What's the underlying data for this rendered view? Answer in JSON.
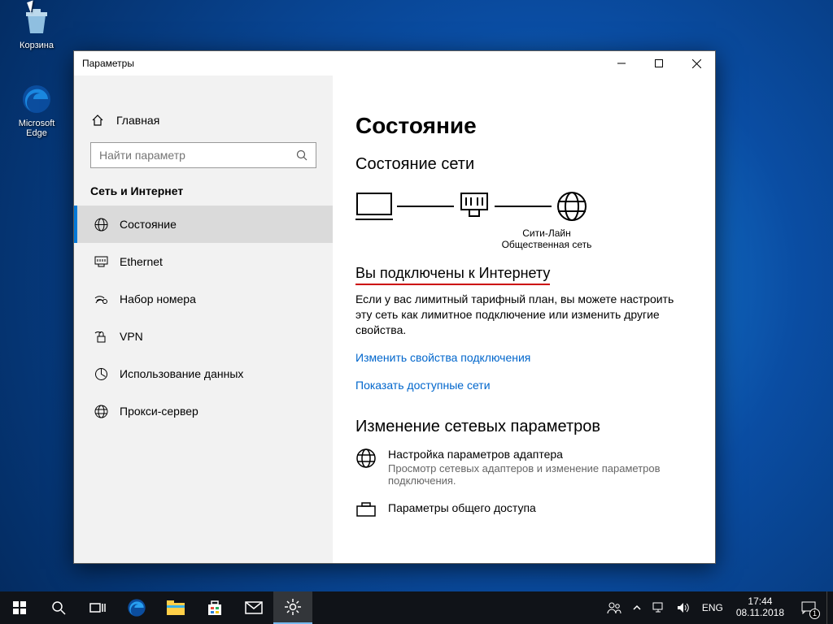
{
  "desktop": {
    "icons": [
      {
        "name": "recycle-bin",
        "label": "Корзина"
      },
      {
        "name": "edge",
        "label": "Microsoft Edge"
      }
    ]
  },
  "window": {
    "title": "Параметры",
    "sidebar": {
      "home": "Главная",
      "search_placeholder": "Найти параметр",
      "section": "Сеть и Интернет",
      "items": [
        {
          "label": "Состояние",
          "active": true
        },
        {
          "label": "Ethernet",
          "active": false
        },
        {
          "label": "Набор номера",
          "active": false
        },
        {
          "label": "VPN",
          "active": false
        },
        {
          "label": "Использование данных",
          "active": false
        },
        {
          "label": "Прокси-сервер",
          "active": false
        }
      ]
    },
    "content": {
      "h1": "Состояние",
      "h2": "Состояние сети",
      "net_name": "Сити-Лайн",
      "net_type": "Общественная сеть",
      "connected_title": "Вы подключены к Интернету",
      "connected_desc": "Если у вас лимитный тарифный план, вы можете настроить эту сеть как лимитное подключение или изменить другие свойства.",
      "link1": "Изменить свойства подключения",
      "link2": "Показать доступные сети",
      "h3": "Изменение сетевых параметров",
      "opt1_title": "Настройка параметров адаптера",
      "opt1_desc": "Просмотр сетевых адаптеров и изменение параметров подключения.",
      "opt2_title": "Параметры общего доступа"
    }
  },
  "taskbar": {
    "lang": "ENG",
    "time": "17:44",
    "date": "08.11.2018",
    "notif_count": "1"
  }
}
